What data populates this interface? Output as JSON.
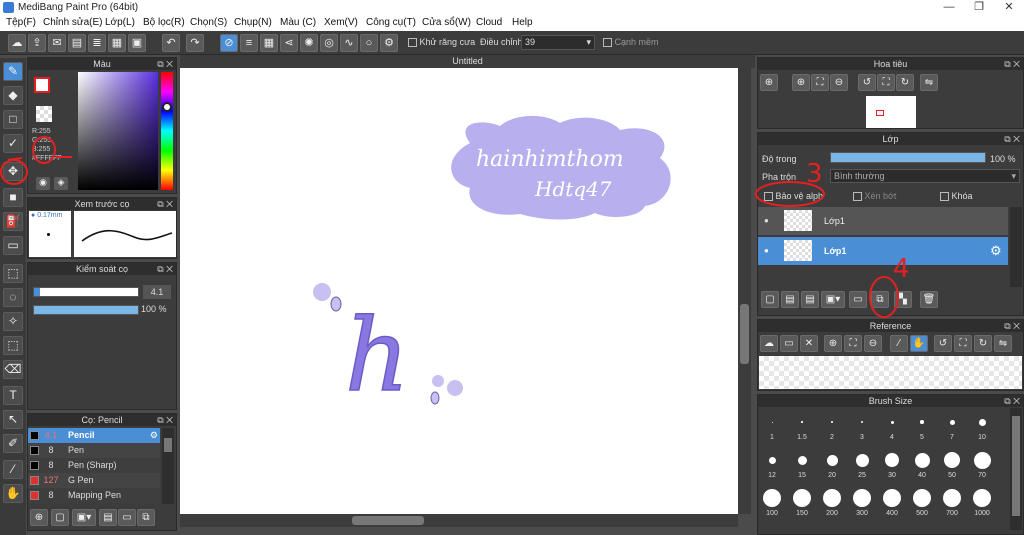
{
  "window": {
    "title": "MediBang Paint Pro (64bit)",
    "minimize": "—",
    "restore": "❐",
    "close": "✕"
  },
  "menu": [
    "Tệp(F)",
    "Chỉnh sửa(E)",
    "Lớp(L)",
    "Bộ lọc(R)",
    "Chọn(S)",
    "Chụp(N)",
    "Màu (C)",
    "Xem(V)",
    "Công cụ(T)",
    "Cửa sổ(W)",
    "Cloud",
    "Help"
  ],
  "toolbar": {
    "antialias_label": "Khử răng cưa",
    "adjust_label": "Điều chỉnh",
    "adjust_value": "39",
    "sharp_edge_label": "Cạnh mềm"
  },
  "color_panel": {
    "title": "Màu",
    "r": "R:255",
    "g": "G:255",
    "b": "B:255",
    "hex": "#FFFFFF"
  },
  "brush_preview": {
    "title": "Xem trước cọ",
    "size": "0.17mm"
  },
  "brush_control": {
    "title": "Kiểm soát cọ",
    "size_value": "4.1",
    "opacity_value": "100 %"
  },
  "brush_list": {
    "title": "Cọ: Pencil",
    "items": [
      {
        "size": "4.1",
        "name": "Pencil",
        "color": "#000000",
        "selected": true
      },
      {
        "size": "8",
        "name": "Pen",
        "color": "#000000"
      },
      {
        "size": "8",
        "name": "Pen (Sharp)",
        "color": "#000000"
      },
      {
        "size": "127",
        "name": "G Pen",
        "color": "#e03030"
      },
      {
        "size": "8",
        "name": "Mapping Pen",
        "color": "#e03030"
      }
    ]
  },
  "canvas": {
    "tab_title": "Untitled",
    "cloud_text_line1": "hainhimthom",
    "cloud_text_line2": "Hdtq47",
    "letter": "h"
  },
  "navigator": {
    "title": "Hoa tiêu"
  },
  "layer_panel": {
    "title": "Lớp",
    "opacity_label": "Độ trong",
    "opacity_value": "100 %",
    "blend_label": "Pha trộn",
    "blend_value": "Bình thường",
    "protect_alpha": "Bảo vệ alph",
    "clipping": "Xén bớt",
    "lock": "Khóa",
    "layers": [
      {
        "name": "Lớp1",
        "selected": false
      },
      {
        "name": "Lớp1",
        "selected": true
      }
    ]
  },
  "reference": {
    "title": "Reference"
  },
  "brush_size": {
    "title": "Brush Size",
    "sizes": [
      "1",
      "1.5",
      "2",
      "3",
      "4",
      "5",
      "7",
      "10",
      "12",
      "15",
      "20",
      "25",
      "30",
      "40",
      "50",
      "70",
      "100",
      "150",
      "200",
      "300",
      "400",
      "500",
      "700",
      "1000"
    ]
  },
  "annotations": {
    "num3": "3",
    "num4": "4"
  },
  "colors": {
    "accent": "#4a8fd6",
    "panel": "#3c3c3c",
    "cloud": "#b8b0ee",
    "letter": "#8a78e0",
    "annotation": "#e52020"
  }
}
